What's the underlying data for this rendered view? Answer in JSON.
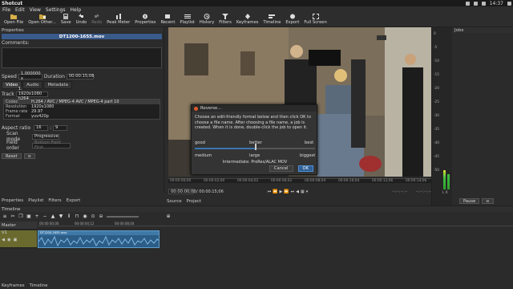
{
  "system": {
    "app_title": "Shotcut",
    "clock": "14:37"
  },
  "menu": [
    "File",
    "Edit",
    "View",
    "Settings",
    "Help"
  ],
  "toolbar": [
    {
      "label": "Open File",
      "icon": "folder-open-icon"
    },
    {
      "label": "Open Other...",
      "icon": "open-other-icon"
    },
    {
      "label": "Save",
      "icon": "save-icon"
    },
    {
      "label": "Undo",
      "icon": "undo-icon"
    },
    {
      "label": "Redo",
      "icon": "redo-icon",
      "disabled": true
    },
    {
      "label": "Peak Meter",
      "icon": "peak-meter-icon"
    },
    {
      "label": "Properties",
      "icon": "properties-icon"
    },
    {
      "label": "Recent",
      "icon": "recent-icon"
    },
    {
      "label": "Playlist",
      "icon": "playlist-icon"
    },
    {
      "label": "History",
      "icon": "history-icon"
    },
    {
      "label": "Filters",
      "icon": "filters-icon"
    },
    {
      "label": "Keyframes",
      "icon": "keyframes-icon"
    },
    {
      "label": "Timeline",
      "icon": "timeline-icon"
    },
    {
      "label": "Export",
      "icon": "export-icon"
    },
    {
      "label": "Full Screen",
      "icon": "fullscreen-icon"
    }
  ],
  "properties": {
    "dock_title": "Properties",
    "filename": "DT1200-1655.mov",
    "comments_label": "Comments:",
    "speed_label": "Speed",
    "speed_value": "1.000000 x",
    "duration_label": "Duration",
    "duration_value": "00:00:15;06",
    "tabs": [
      "Video",
      "Audio",
      "Metadata"
    ],
    "track_label": "Track",
    "track_value": "1: 1920x1080 h264",
    "info": [
      {
        "k": "Codec",
        "v": "H.264 / AVC / MPEG-4 AVC / MPEG-4 part 10"
      },
      {
        "k": "Resolution",
        "v": "1920x1080"
      },
      {
        "k": "Frame rate",
        "v": "29.97"
      },
      {
        "k": "Format",
        "v": "yuv420p"
      }
    ],
    "aspect_label": "Aspect ratio",
    "aspect_w": "16",
    "aspect_h": "9",
    "scan_label": "Scan mode",
    "scan_value": "Progressive",
    "field_label": "Field order",
    "field_value": "Bottom Field First",
    "reset_label": "Reset"
  },
  "left_tabs": [
    "Properties",
    "Playlist",
    "Filters",
    "Export"
  ],
  "player": {
    "timecode": "00:00:00;00",
    "duration": "/ 00:00:15;06",
    "in_point": "--:--:--:--",
    "out_point": "--:--:--:--",
    "ruler": [
      "00:00:00;00",
      "00:00:02;00",
      "00:00:04;02",
      "00:00:06;02",
      "00:00:08;04",
      "00:00:10;04",
      "00:00:12;06",
      "00:00:14;06"
    ],
    "tabs": [
      "Source",
      "Project"
    ]
  },
  "meter": {
    "scale": [
      "0",
      "-5",
      "-10",
      "-15",
      "-20",
      "-25",
      "-30",
      "-35",
      "-40",
      "-45",
      "-50"
    ],
    "channels": "L R"
  },
  "jobs": {
    "title": "Jobs",
    "pause_label": "Pause"
  },
  "timeline": {
    "title": "Timeline",
    "master_label": "Master",
    "track_name": "V1",
    "clip_name": "DT1200-1655.mov",
    "ruler": [
      "00:00:00;00",
      "00:00:04;12",
      "00:00:08;04"
    ],
    "bottom_tabs": [
      "Keyframes",
      "Timeline"
    ]
  },
  "dialog": {
    "title": "Reverse...",
    "message": "Choose an edit-friendly format below and then click OK to choose a file name. After choosing a file name, a job is created. When it is done, double-click the job to open it.",
    "top_labels": [
      "good",
      "better",
      "best"
    ],
    "bottom_labels": [
      "medium",
      "large",
      "biggest"
    ],
    "result": "Intermediate: ProRes/ALAC MOV",
    "cancel_label": "Cancel",
    "ok_label": "OK"
  }
}
